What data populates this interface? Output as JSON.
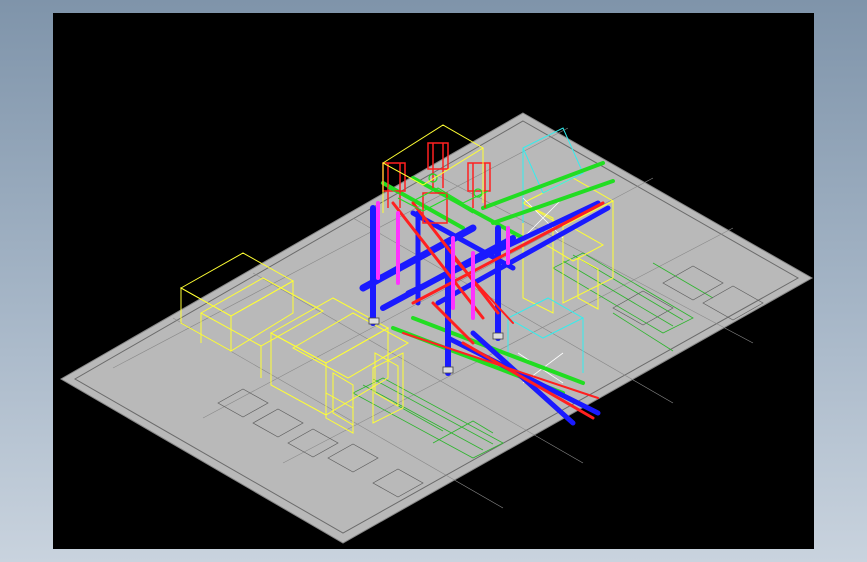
{
  "window": {
    "background": "#8fa2b6"
  },
  "viewport": {
    "background": "#000000"
  },
  "drawing": {
    "sheet_color": "#b9b9b9",
    "palette": {
      "yellow": "#ffff33",
      "blue": "#1a1aff",
      "red": "#ff2020",
      "magenta": "#ff33ff",
      "green": "#22dd22",
      "cyan": "#33eeee",
      "white": "#ffffff",
      "line": "#666666"
    }
  }
}
